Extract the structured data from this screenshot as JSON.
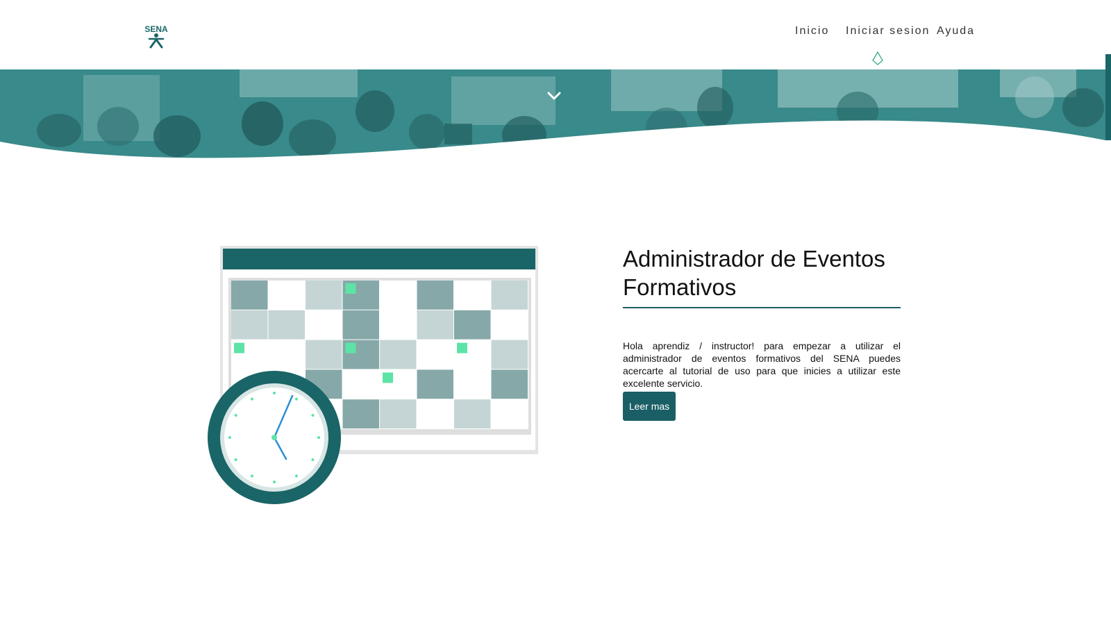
{
  "brand": {
    "logo_text": "SENA",
    "accent": "#1a6567",
    "highlight": "#5de3a6"
  },
  "nav": {
    "items": [
      {
        "label": "Inicio"
      },
      {
        "label": "Iniciar sesion"
      },
      {
        "label": "Ayuda"
      }
    ],
    "active_indicator_icon": "diamond-outline-icon"
  },
  "hero": {
    "scroll_icon": "chevron-down-icon"
  },
  "main": {
    "title": "Administrador de Eventos Formativos",
    "description": "Hola aprendiz / instructor! para empezar a utilizar el administrador de eventos formativos del SENA puedes acercarte al tutorial de uso para que inicies a utilizar este excelente servicio.",
    "button_label": "Leer mas",
    "illustration_icons": [
      "calendar-icon",
      "clock-icon"
    ]
  }
}
